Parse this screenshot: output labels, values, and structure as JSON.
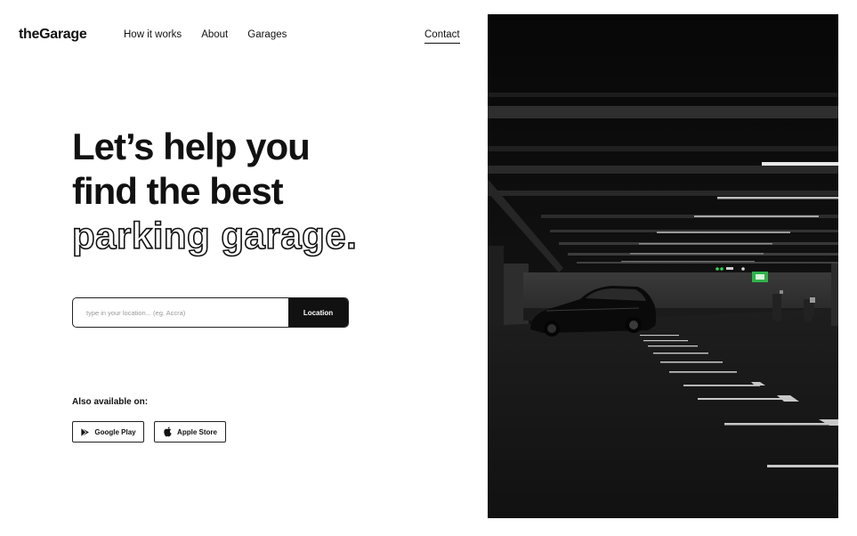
{
  "nav": {
    "brand": "theGarage",
    "links": [
      "How it works",
      "About",
      "Garages"
    ],
    "contact": "Contact"
  },
  "hero": {
    "line1": "Let’s help you",
    "line2": "find the best",
    "line3": "parking garage."
  },
  "search": {
    "placeholder": "type in your location... (eg. Accra)",
    "button_label": "Location"
  },
  "availability": {
    "heading": "Also available on:",
    "stores": [
      {
        "label": "Google Play",
        "icon": "google-play-icon"
      },
      {
        "label": "Apple Store",
        "icon": "apple-icon"
      }
    ]
  },
  "image": {
    "subject": "dark parking garage with parked car",
    "colors": {
      "ceiling_light": "#e6e6e6",
      "exit_sign": "#2fb24a",
      "background": "#0c0c0c"
    }
  }
}
